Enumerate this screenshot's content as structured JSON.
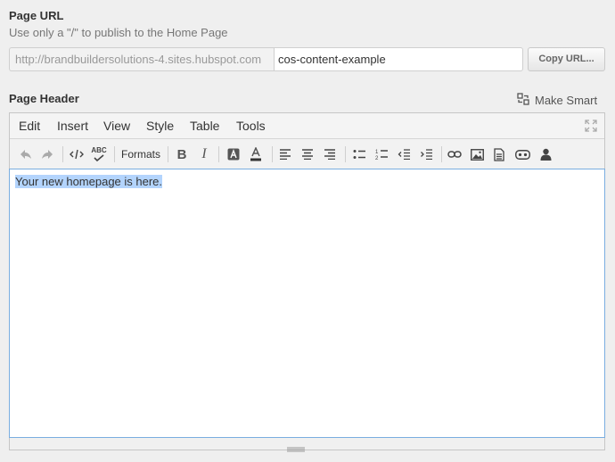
{
  "page_url": {
    "label": "Page URL",
    "help_text": "Use only a \"/\" to publish to the Home Page",
    "domain": "http://brandbuildersolutions-4.sites.hubspot.com",
    "slug": "cos-content-example",
    "copy_button": "Copy URL..."
  },
  "page_header": {
    "label": "Page Header",
    "make_smart": "Make Smart"
  },
  "editor": {
    "menu": [
      "Edit",
      "Insert",
      "View",
      "Style",
      "Table",
      "Tools"
    ],
    "toolbar": {
      "formats": "Formats",
      "spellcheck": "ABC"
    },
    "content": "Your new homepage is here."
  }
}
